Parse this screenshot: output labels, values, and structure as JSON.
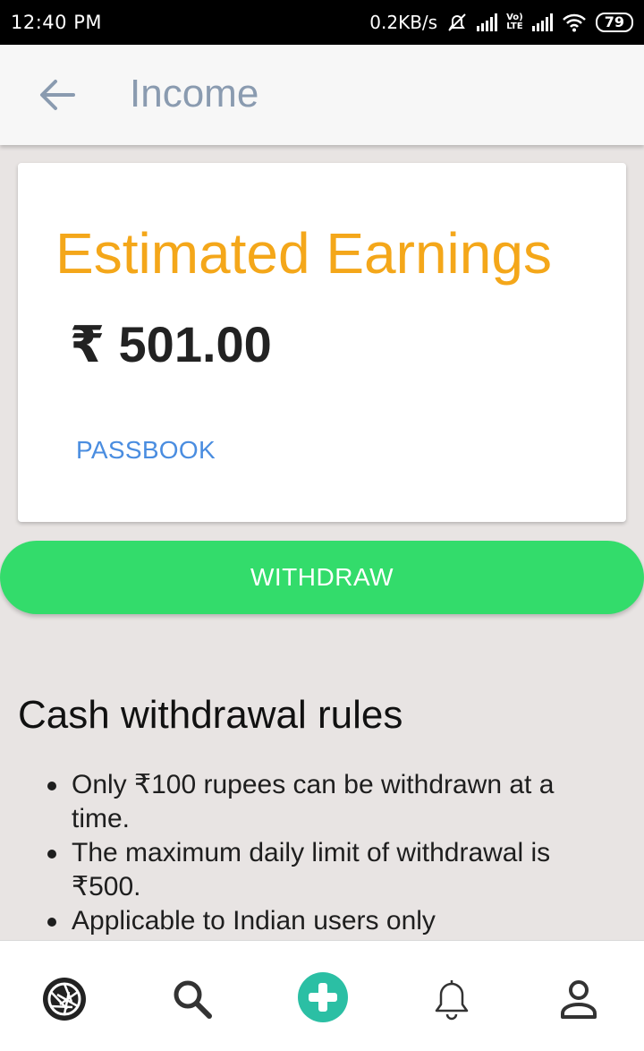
{
  "status_bar": {
    "time": "12:40 PM",
    "network_speed": "0.2KB/s",
    "lte_top": "Vo)",
    "lte_bottom": "LTE",
    "battery": "79"
  },
  "app_bar": {
    "title": "Income",
    "back_icon": "arrow-left-icon"
  },
  "earnings_card": {
    "title": "Estimated Earnings",
    "amount": "₹ 501.00",
    "passbook_label": "PASSBOOK"
  },
  "withdraw_button": {
    "label": "WITHDRAW"
  },
  "rules": {
    "title": "Cash withdrawal rules",
    "items": [
      "Only ₹100 rupees can be withdrawn at a time.",
      "The maximum daily limit of withdrawal is ₹500.",
      "Applicable to Indian users only"
    ]
  },
  "bottom_nav": {
    "items": [
      {
        "icon": "aperture-icon"
      },
      {
        "icon": "search-icon"
      },
      {
        "icon": "plus-circle-icon"
      },
      {
        "icon": "bell-icon"
      },
      {
        "icon": "user-icon"
      }
    ]
  },
  "colors": {
    "accent_orange": "#f4a71a",
    "link_blue": "#4a8de0",
    "withdraw_green": "#33dc6b",
    "add_teal": "#2bbfa4",
    "title_gray_blue": "#8a9bb0"
  }
}
